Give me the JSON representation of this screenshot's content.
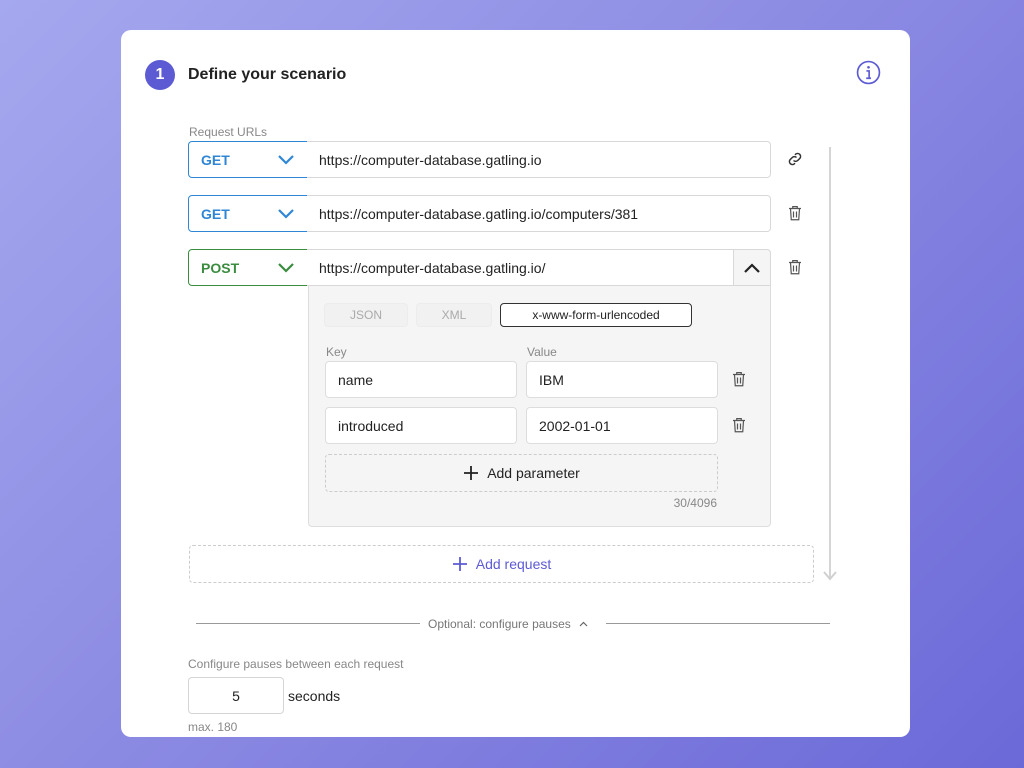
{
  "step": {
    "number": "1",
    "title": "Define your scenario"
  },
  "request_urls_label": "Request URLs",
  "requests": [
    {
      "method": "GET",
      "url": "https://computer-database.gatling.io",
      "action_icon": "link-icon",
      "method_color": "#2f86d6"
    },
    {
      "method": "GET",
      "url": "https://computer-database.gatling.io/computers/381",
      "action_icon": "trash-icon",
      "method_color": "#2f86d6"
    },
    {
      "method": "POST",
      "url": "https://computer-database.gatling.io/",
      "action_icon": "trash-icon",
      "method_color": "#3a8c3f"
    }
  ],
  "body": {
    "tabs": [
      "JSON",
      "XML",
      "x-www-form-urlencoded"
    ],
    "active_tab": "x-www-form-urlencoded",
    "key_label": "Key",
    "value_label": "Value",
    "params": [
      {
        "key": "name",
        "value": "IBM"
      },
      {
        "key": "introduced",
        "value": "2002-01-01"
      }
    ],
    "add_parameter": "Add parameter",
    "char_count": "30/4096"
  },
  "add_request": "Add request",
  "pauses": {
    "toggle": "Optional: configure pauses",
    "label": "Configure pauses between each request",
    "value": "5",
    "unit": "seconds",
    "hint": "max. 180"
  },
  "colors": {
    "accent": "#5d5bd4"
  }
}
